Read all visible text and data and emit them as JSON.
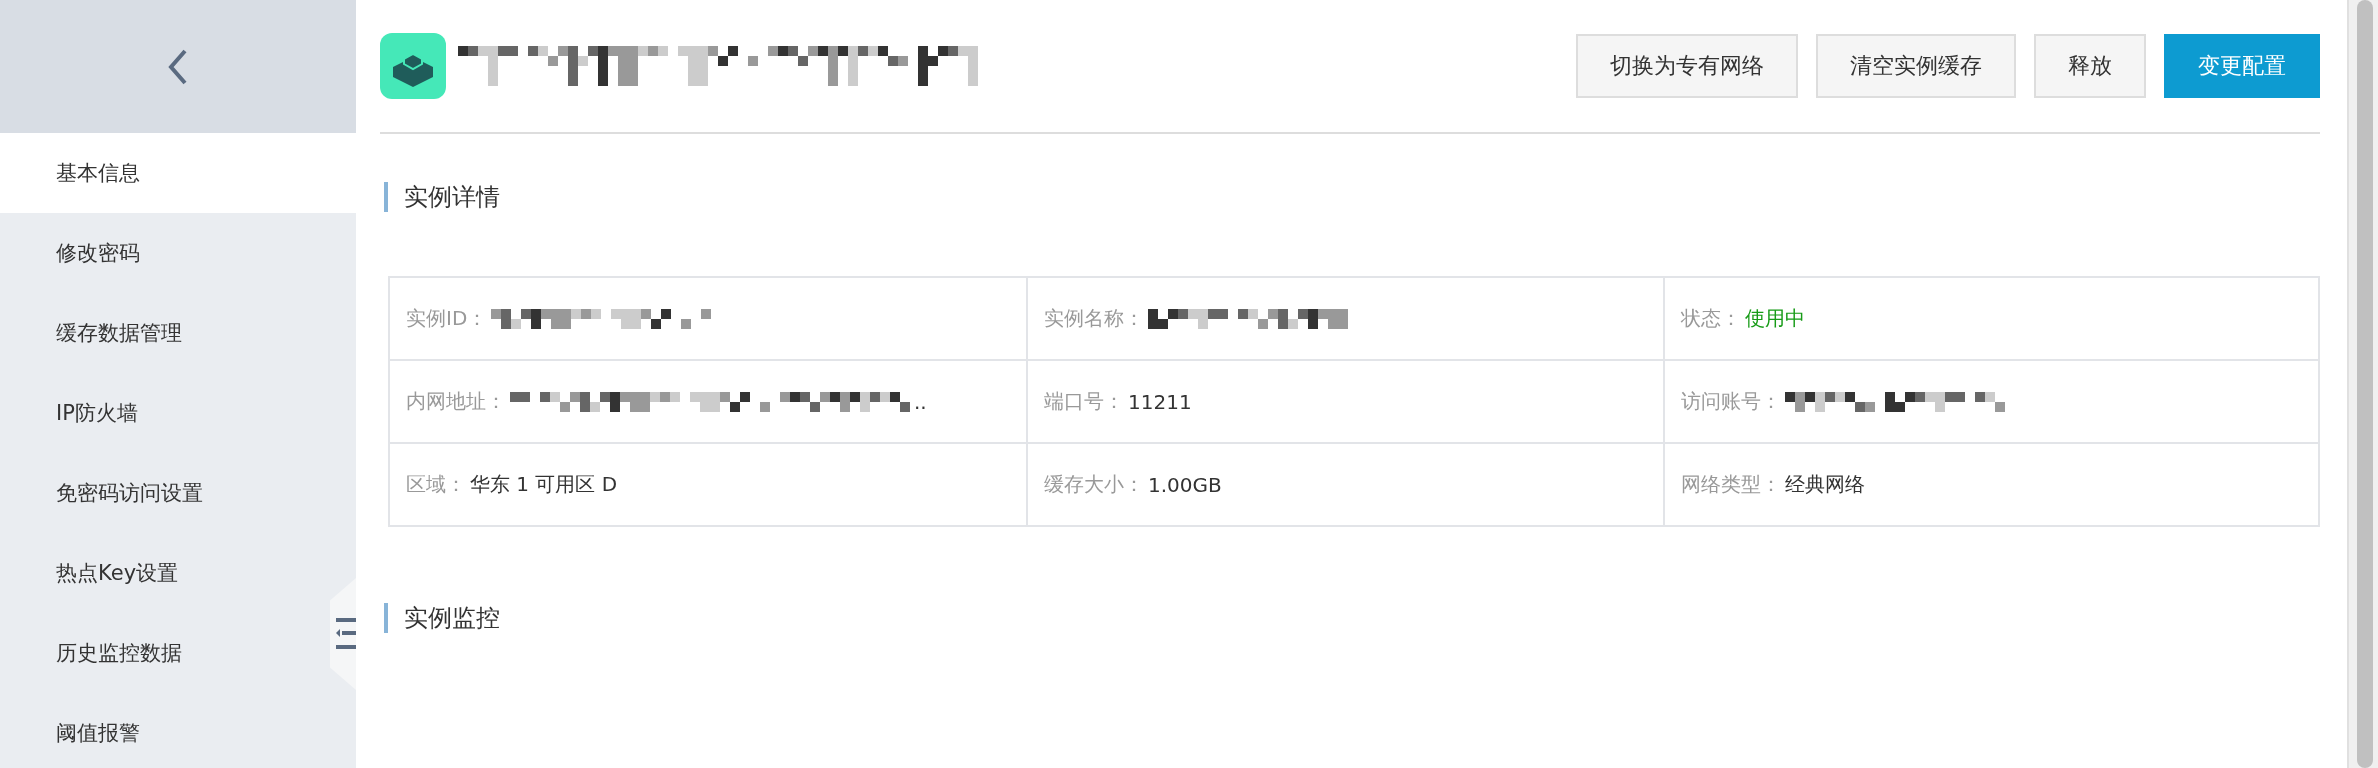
{
  "sidebar": {
    "items": [
      {
        "label": "基本信息",
        "selected": true
      },
      {
        "label": "修改密码",
        "selected": false
      },
      {
        "label": "缓存数据管理",
        "selected": false
      },
      {
        "label": "IP防火墙",
        "selected": false
      },
      {
        "label": "免密码访问设置",
        "selected": false
      },
      {
        "label": "热点Key设置",
        "selected": false
      },
      {
        "label": "历史监控数据",
        "selected": false
      },
      {
        "label": "阈值报警",
        "selected": false
      }
    ]
  },
  "header": {
    "title": {
      "kind": "redacted"
    },
    "buttons": [
      {
        "label": "切换为专有网络",
        "kind": "default"
      },
      {
        "label": "清空实例缓存",
        "kind": "default"
      },
      {
        "label": "释放",
        "kind": "default"
      },
      {
        "label": "变更配置",
        "kind": "primary"
      }
    ]
  },
  "sections": [
    {
      "title": "实例详情",
      "fields": [
        {
          "label": "实例ID：",
          "kind": "redacted"
        },
        {
          "label": "实例名称：",
          "kind": "redacted"
        },
        {
          "label": "状态：",
          "kind": "status",
          "value": "使用中"
        },
        {
          "label": "内网地址：",
          "kind": "redacted",
          "suffix": ".."
        },
        {
          "label": "端口号：",
          "kind": "text",
          "value": "11211"
        },
        {
          "label": "访问账号：",
          "kind": "redacted"
        },
        {
          "label": "区域：",
          "kind": "text",
          "value": "华东 1 可用区 D"
        },
        {
          "label": "缓存大小：",
          "kind": "text",
          "value": "1.00GB"
        },
        {
          "label": "网络类型：",
          "kind": "text",
          "value": "经典网络"
        }
      ]
    },
    {
      "title": "实例监控"
    }
  ]
}
